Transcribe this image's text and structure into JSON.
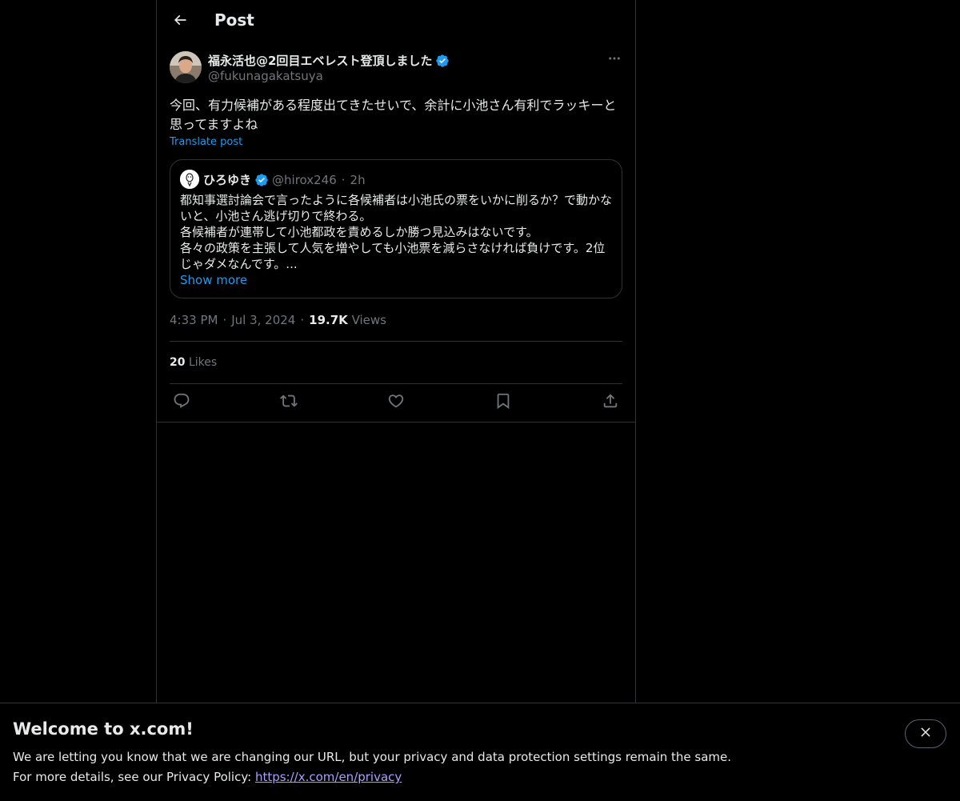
{
  "header": {
    "title": "Post"
  },
  "post": {
    "author_name": "福永活也@2回目エベレスト登頂しました",
    "author_handle": "@fukunagakatsuya",
    "text": "今回、有力候補がある程度出てきたせいで、余計に小池さん有利でラッキーと思ってますよね",
    "translate_label": "Translate post",
    "time": "4:33 PM",
    "date": "Jul 3, 2024",
    "views_count": "19.7K",
    "views_label": "Views",
    "likes_count": "20",
    "likes_label": "Likes"
  },
  "quote": {
    "author_name": "ひろゆき",
    "author_handle": "@hirox246",
    "time_ago": "2h",
    "lines": [
      "都知事選討論会で言ったように各候補者は小池氏の票をいかに削るか？で動かな",
      "いと、小池さん逃げ切りで終わる。",
      "各候補者が連帯して小池都政を責めるしか勝つ見込みはないです。",
      "各々の政策を主張して人気を増やしても小池票を減らさなければ負けです。2位",
      "じゃダメなんです。..."
    ],
    "show_more": "Show more"
  },
  "banner": {
    "title": "Welcome to x.com!",
    "line1": "We are letting you know that we are changing our URL, but your privacy and data protection settings remain the same.",
    "line2_prefix": "For more details, see our Privacy Policy: ",
    "link": "https://x.com/en/privacy"
  },
  "colors": {
    "background": "#000000",
    "text": "#e7e9ea",
    "muted": "#71767b",
    "accent": "#1d9bf0",
    "border": "#2f3336",
    "link_visited": "#a89fff"
  },
  "icons": {
    "back": "arrow-left-icon",
    "more": "more-horizontal-icon",
    "verified": "verified-badge-icon",
    "reply": "reply-icon",
    "repost": "repost-icon",
    "like": "heart-icon",
    "bookmark": "bookmark-icon",
    "share": "share-icon",
    "close": "close-icon"
  }
}
